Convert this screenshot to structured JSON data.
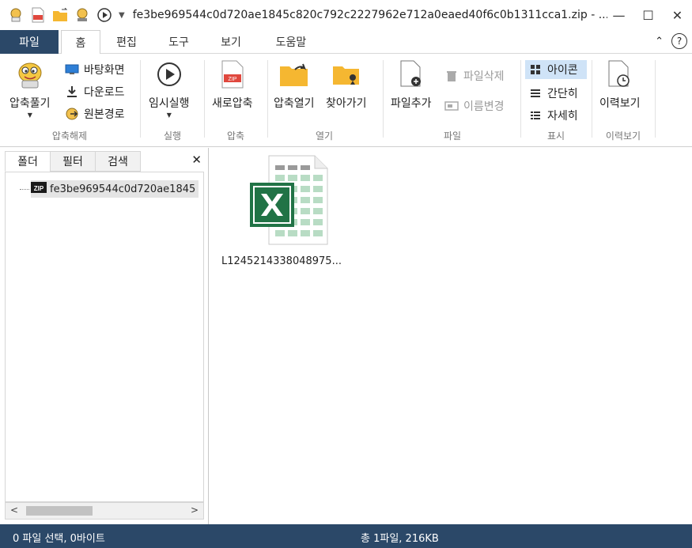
{
  "title_bar": {
    "window_title": "fe3be969544c0d720ae1845c820c792c2227962e712a0eaed40f6c0b1311cca1.zip - ...",
    "quick_access_icons": [
      "app-logo-icon",
      "new-zip-icon",
      "open-folder-icon",
      "extract-icon",
      "play-icon",
      "dropdown-arrow-icon"
    ],
    "controls": {
      "minimize": "—",
      "maximize": "☐",
      "close": "✕"
    }
  },
  "tabs": {
    "file": "파일",
    "home": "홈",
    "edit": "편집",
    "tools": "도구",
    "view": "보기",
    "help": "도움말",
    "collapse_icon": "⌃",
    "help_icon": "?"
  },
  "ribbon": {
    "extract_group": {
      "label": "압축해제",
      "extract_button": "압축풀기",
      "desktop": "바탕화면",
      "download": "다운로드",
      "original_path": "원본경로"
    },
    "run_group": {
      "label": "실행",
      "temp_run": "임시실행"
    },
    "compress_group": {
      "label": "압축",
      "new_zip": "새로압축"
    },
    "open_group": {
      "label": "열기",
      "open_zip": "압축열기",
      "locate": "찾아가기"
    },
    "file_group": {
      "label": "파일",
      "add_file": "파일추가",
      "delete_file": "파일삭제",
      "rename": "이름변경"
    },
    "display_group": {
      "label": "표시",
      "icon": "아이콘",
      "simple": "간단히",
      "detail": "자세히"
    },
    "history_group": {
      "label": "이력보기",
      "history": "이력보기"
    }
  },
  "left_pane": {
    "tabs": [
      "폴더",
      "필터",
      "검색"
    ],
    "close": "✕",
    "tree_item": "fe3be969544c0d720ae1845",
    "scroll_left": "<",
    "scroll_right": ">"
  },
  "content": {
    "files": [
      {
        "name": "L1245214338048975...",
        "type_icon": "excel-file-icon"
      }
    ]
  },
  "status_bar": {
    "selection": "0 파일 선택,  0바이트",
    "total": "총 1파일,  216KB"
  },
  "colors": {
    "accent": "#2b4868",
    "active_view": "#cfe3f7",
    "excel_green": "#217346"
  }
}
